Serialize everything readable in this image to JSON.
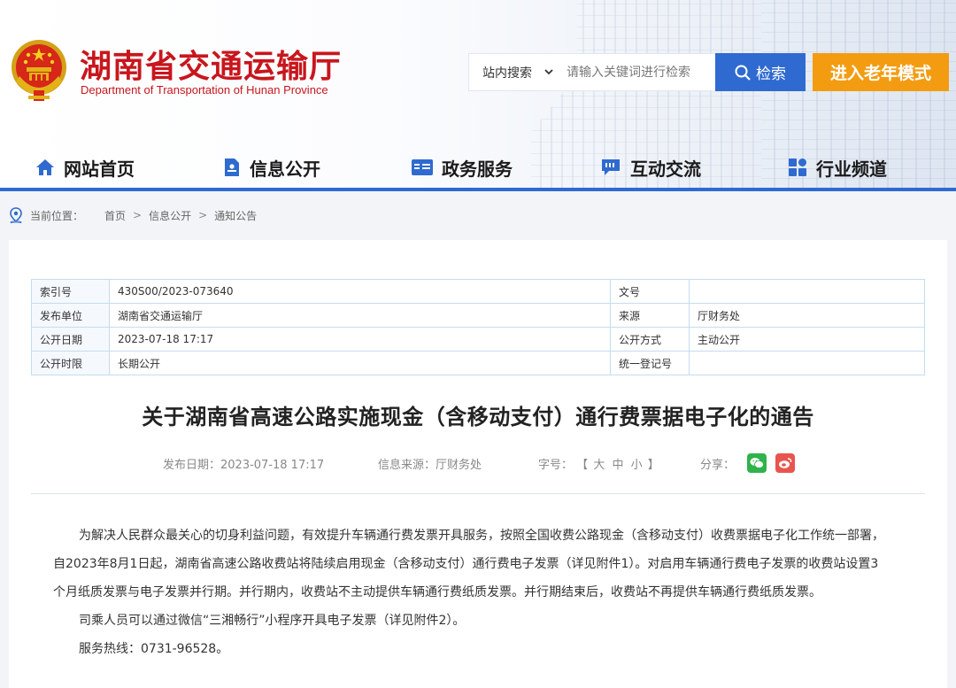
{
  "site": {
    "title": "湖南省交通运输厅",
    "subtitle": "Department of Transportation of Hunan Province"
  },
  "search": {
    "scope": "站内搜索",
    "placeholder": "请输入关键词进行检索",
    "button": "检索"
  },
  "elder_mode": "进入老年模式",
  "nav": [
    {
      "label": "网站首页",
      "icon": "home-icon"
    },
    {
      "label": "信息公开",
      "icon": "document-icon"
    },
    {
      "label": "政务服务",
      "icon": "id-card-icon"
    },
    {
      "label": "互动交流",
      "icon": "chat-icon"
    },
    {
      "label": "行业频道",
      "icon": "grid-icon"
    }
  ],
  "colors": {
    "brand_red": "#c8161d",
    "primary_blue": "#2f6ad0",
    "elder_orange": "#f39c12"
  },
  "breadcrumb": {
    "prefix": "当前位置：",
    "items": [
      "首页",
      "信息公开",
      "通知公告"
    ],
    "separator": ">"
  },
  "meta_table": [
    {
      "k1": "索引号",
      "v1": "430S00/2023-073640",
      "k2": "文号",
      "v2": ""
    },
    {
      "k1": "发布单位",
      "v1": "湖南省交通运输厅",
      "k2": "来源",
      "v2": "厅财务处"
    },
    {
      "k1": "公开日期",
      "v1": "2023-07-18 17:17",
      "k2": "公开方式",
      "v2": "主动公开"
    },
    {
      "k1": "公开时限",
      "v1": "长期公开",
      "k2": "统一登记号",
      "v2": ""
    }
  ],
  "article": {
    "title": "关于湖南省高速公路实施现金（含移动支付）通行费票据电子化的通告",
    "date": "发布日期：2023-07-18 17:17",
    "source": "信息来源：厅财务处",
    "font_size_label": "字号：",
    "font_size_open": "【",
    "font_sizes": [
      "大",
      "中",
      "小"
    ],
    "font_size_close": "】",
    "share_label": "分享：",
    "paragraphs": [
      "为解决人民群众最关心的切身利益问题，有效提升车辆通行费发票开具服务，按照全国收费公路现金（含移动支付）收费票据电子化工作统一部署，",
      "自2023年8月1日起，湖南省高速公路收费站将陆续启用现金（含移动支付）通行费电子发票（详见附件1）。对启用车辆通行费电子发票的收费站设置3",
      "个月纸质发票与电子发票并行期。并行期内，收费站不主动提供车辆通行费纸质发票。并行期结束后，收费站不再提供车辆通行费纸质发票。",
      "司乘人员可以通过微信“三湘畅行”小程序开具电子发票（详见附件2）。",
      "服务热线：0731-96528。"
    ]
  }
}
